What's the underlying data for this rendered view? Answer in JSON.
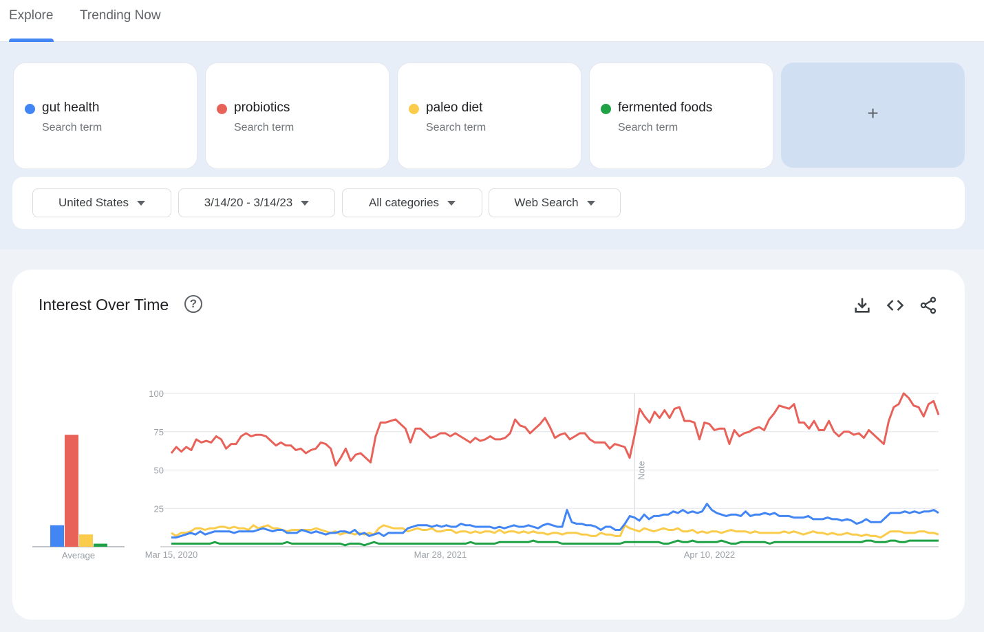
{
  "nav": {
    "tabs": [
      {
        "label": "Explore",
        "active": true
      },
      {
        "label": "Trending Now",
        "active": false
      }
    ],
    "accent_color": "#4285f4"
  },
  "terms": [
    {
      "name": "gut health",
      "type": "Search term",
      "color": "#4285f4"
    },
    {
      "name": "probiotics",
      "type": "Search term",
      "color": "#e8625a"
    },
    {
      "name": "paleo diet",
      "type": "Search term",
      "color": "#fbcc4b"
    },
    {
      "name": "fermented foods",
      "type": "Search term",
      "color": "#1fa245"
    }
  ],
  "add_term": {
    "label": "+"
  },
  "filters": {
    "region": "United States",
    "date_range": "3/14/20 - 3/14/23",
    "category": "All categories",
    "search_type": "Web Search"
  },
  "panel": {
    "title": "Interest Over Time",
    "help_icon": "question-circle-icon",
    "actions": [
      "download-icon",
      "embed-code-icon",
      "share-icon"
    ]
  },
  "chart_data": {
    "type": "line",
    "title": "Interest Over Time",
    "ylim": [
      0,
      100
    ],
    "yticks": [
      25,
      50,
      75,
      100
    ],
    "xtick_labels": [
      "Mar 15, 2020",
      "Mar 28, 2021",
      "Apr 10, 2022"
    ],
    "xtick_index": [
      0,
      54,
      108
    ],
    "note_index": 93,
    "note_label": "Note",
    "grid": true,
    "average_label": "Average",
    "averages": [
      14,
      73,
      8,
      2
    ],
    "series": [
      {
        "name": "gut health",
        "color": "#4285f4",
        "values": [
          6,
          6,
          7,
          8,
          9,
          8,
          10,
          8,
          9,
          10,
          10,
          10,
          10,
          9,
          10,
          10,
          10,
          10,
          11,
          12,
          11,
          10,
          11,
          11,
          9,
          9,
          9,
          11,
          10,
          9,
          10,
          9,
          8,
          9,
          9,
          10,
          10,
          9,
          11,
          8,
          9,
          7,
          8,
          9,
          7,
          9,
          9,
          9,
          9,
          12,
          13,
          14,
          14,
          14,
          13,
          14,
          13,
          14,
          13,
          13,
          15,
          14,
          14,
          13,
          13,
          13,
          13,
          12,
          13,
          12,
          13,
          14,
          13,
          13,
          14,
          13,
          12,
          14,
          15,
          14,
          13,
          13,
          24,
          16,
          15,
          15,
          14,
          14,
          13,
          11,
          13,
          13,
          11,
          11,
          15,
          20,
          19,
          17,
          21,
          18,
          20,
          20,
          21,
          21,
          23,
          22,
          24,
          22,
          23,
          22,
          23,
          28,
          24,
          22,
          21,
          20,
          21,
          21,
          20,
          23,
          20,
          21,
          21,
          22,
          21,
          22,
          20,
          20,
          20,
          19,
          19,
          19,
          20,
          18,
          18,
          18,
          19,
          18,
          18,
          17,
          18,
          17,
          15,
          16,
          18,
          16,
          16,
          16,
          19,
          22,
          22,
          22,
          23,
          22,
          23,
          22,
          23,
          23,
          24,
          22
        ],
        "segment": "probiotics_ignore"
      },
      {
        "name": "probiotics",
        "color": "#e8625a",
        "values": [
          61,
          65,
          62,
          65,
          63,
          70,
          68,
          69,
          68,
          72,
          70,
          64,
          67,
          67,
          72,
          74,
          72,
          73,
          73,
          72,
          69,
          66,
          68,
          66,
          66,
          63,
          64,
          61,
          63,
          64,
          68,
          67,
          64,
          53,
          58,
          64,
          56,
          60,
          61,
          58,
          55,
          72,
          81,
          81,
          82,
          83,
          80,
          77,
          68,
          77,
          77,
          74,
          71,
          72,
          74,
          74,
          72,
          74,
          72,
          70,
          68,
          71,
          69,
          70,
          72,
          70,
          70,
          71,
          74,
          83,
          79,
          78,
          74,
          77,
          80,
          84,
          78,
          71,
          73,
          74,
          70,
          72,
          74,
          74,
          70,
          68,
          68,
          68,
          64,
          67,
          66,
          65,
          58,
          73,
          90,
          85,
          81,
          88,
          84,
          89,
          84,
          90,
          91,
          82,
          82,
          81,
          70,
          81,
          80,
          76,
          77,
          77,
          67,
          76,
          72,
          74,
          75,
          77,
          78,
          76,
          83,
          87,
          92,
          91,
          90,
          93,
          81,
          81,
          77,
          82,
          76,
          76,
          82,
          75,
          72,
          75,
          75,
          73,
          74,
          71,
          76,
          73,
          70,
          67,
          82,
          91,
          93,
          100,
          97,
          92,
          91,
          85,
          93,
          95,
          86
        ]
      },
      {
        "name": "paleo diet",
        "color": "#fbcc4b",
        "values": [
          9,
          7,
          9,
          9,
          10,
          12,
          12,
          11,
          12,
          12,
          13,
          13,
          12,
          13,
          12,
          12,
          11,
          14,
          12,
          13,
          14,
          12,
          12,
          11,
          10,
          11,
          11,
          11,
          11,
          11,
          12,
          11,
          10,
          9,
          10,
          8,
          9,
          9,
          8,
          9,
          8,
          9,
          8,
          12,
          14,
          13,
          12,
          12,
          12,
          10,
          11,
          12,
          11,
          11,
          12,
          10,
          10,
          11,
          11,
          9,
          10,
          10,
          9,
          10,
          9,
          10,
          10,
          9,
          11,
          9,
          10,
          10,
          9,
          10,
          9,
          10,
          9,
          9,
          8,
          9,
          9,
          8,
          9,
          9,
          9,
          8,
          8,
          7,
          7,
          9,
          8,
          8,
          7,
          7,
          14,
          12,
          11,
          10,
          12,
          11,
          10,
          11,
          12,
          11,
          11,
          12,
          10,
          10,
          11,
          9,
          10,
          9,
          10,
          10,
          9,
          10,
          11,
          10,
          10,
          10,
          9,
          10,
          9,
          9,
          9,
          9,
          9,
          10,
          9,
          10,
          9,
          8,
          9,
          10,
          9,
          9,
          8,
          9,
          8,
          8,
          9,
          8,
          8,
          7,
          8,
          7,
          7,
          6,
          8,
          10,
          10,
          10,
          9,
          9,
          9,
          10,
          10,
          9,
          9,
          8
        ]
      },
      {
        "name": "fermented foods",
        "color": "#1fa245",
        "values": [
          2,
          2,
          2,
          2,
          2,
          2,
          2,
          2,
          2,
          3,
          2,
          2,
          2,
          2,
          2,
          2,
          2,
          2,
          2,
          2,
          2,
          2,
          2,
          2,
          3,
          2,
          2,
          2,
          2,
          2,
          2,
          2,
          2,
          2,
          2,
          2,
          1,
          2,
          2,
          2,
          1,
          2,
          3,
          2,
          2,
          2,
          2,
          2,
          2,
          2,
          2,
          2,
          2,
          2,
          2,
          2,
          2,
          2,
          2,
          2,
          2,
          2,
          3,
          2,
          2,
          2,
          2,
          2,
          3,
          3,
          3,
          3,
          3,
          3,
          3,
          4,
          3,
          3,
          3,
          3,
          3,
          2,
          2,
          2,
          2,
          2,
          2,
          2,
          2,
          2,
          2,
          2,
          2,
          2,
          3,
          3,
          3,
          3,
          3,
          3,
          3,
          3,
          2,
          2,
          3,
          4,
          3,
          3,
          4,
          3,
          3,
          3,
          3,
          3,
          4,
          3,
          2,
          2,
          3,
          3,
          3,
          3,
          3,
          3,
          2,
          3,
          3,
          3,
          3,
          3,
          3,
          3,
          3,
          3,
          3,
          3,
          3,
          3,
          3,
          3,
          3,
          3,
          3,
          3,
          4,
          4,
          3,
          3,
          3,
          4,
          4,
          3,
          3,
          4,
          4,
          4,
          4,
          4,
          4,
          4
        ]
      }
    ]
  }
}
